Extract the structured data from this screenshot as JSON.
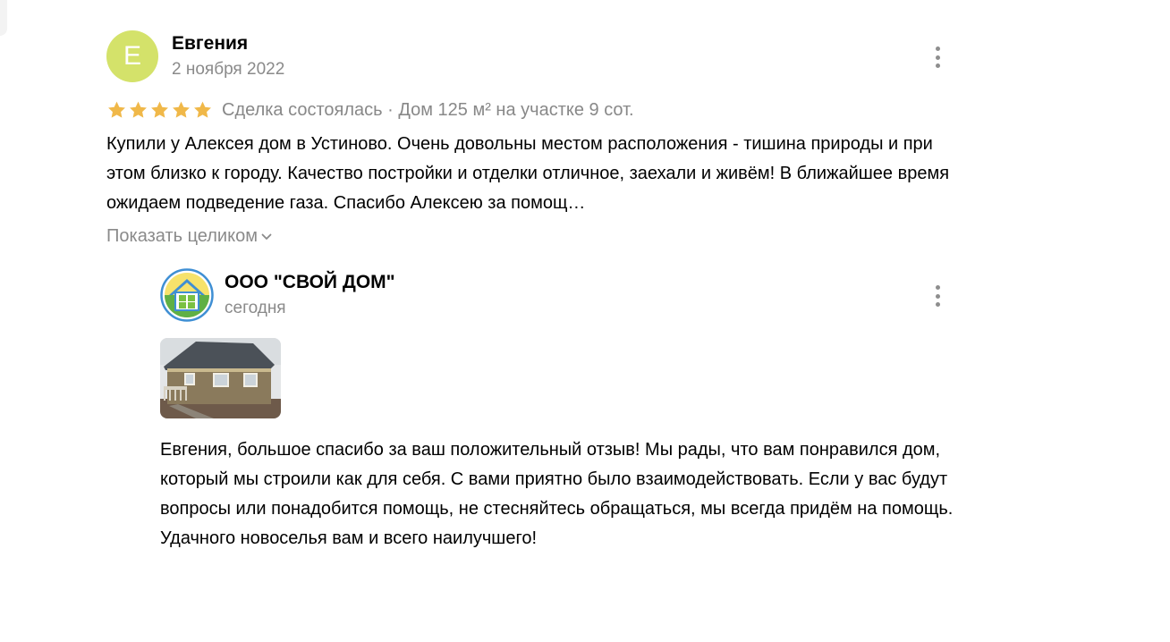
{
  "review": {
    "avatar_letter": "Е",
    "author": "Евгения",
    "date": "2 ноября 2022",
    "rating": 5,
    "meta": "Сделка состоялась · Дом 125 м² на участке 9 сот.",
    "text": "Купили у Алексея дом в Устиново. Очень довольны местом расположения - тишина природы и при этом близко к городу. Качество постройки и отделки отличное, заехали и живём! В ближайшее время ожидаем подведение газа. Спасибо Алексею за помощ…",
    "show_more": "Показать целиком",
    "avatar_color": "#d4e26a",
    "star_color": "#f0b849"
  },
  "reply": {
    "company": "ООО \"СВОЙ ДОМ\"",
    "date": "сегодня",
    "text": "Евгения, большое спасибо за ваш положительный отзыв! Мы рады, что вам понравился дом, который мы строили как для себя. С вами приятно было взаимодействовать. Если у вас будут вопросы или понадобится помощь, не стесняйтесь обращаться, мы всегда придём на помощь. Удачного новоселья вам и всего наилучшего!"
  },
  "icons": {
    "more": "kebab-menu-icon",
    "star": "star-icon",
    "chevron": "chevron-down-icon"
  }
}
